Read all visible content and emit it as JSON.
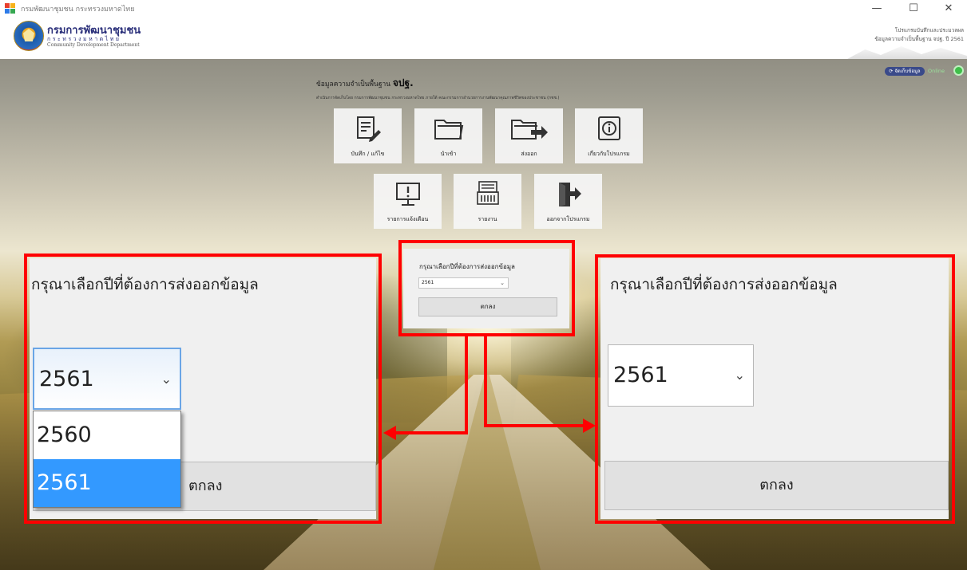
{
  "window": {
    "title": "กรมพัฒนาชุมชน กระทรวงมหาดไทย",
    "minimize_glyph": "—",
    "maximize_glyph": "☐",
    "close_glyph": "✕"
  },
  "header": {
    "org_name_th": "กรมการพัฒนาชุมชน",
    "org_ministry": "กระทรวงมหาดไทย",
    "org_name_en": "Community Development Department",
    "right_line_1": "โปรแกรมบันทึกและประมวลผล",
    "right_line_2": "ข้อมูลความจำเป็นพื้นฐาน จปฐ. ปี 2561"
  },
  "status": {
    "sync_label": "จัดเก็บข้อมูล",
    "online_label": "Online"
  },
  "main": {
    "title_prefix": "ข้อมูลความจำเป็นพื้นฐาน",
    "title_bold": "จปฐ.",
    "description": "ดำเนินการจัดเก็บโดย กรมการพัฒนาชุมชน กระทรวงมหาดไทย ภายใต้ คณะกรรมการอำนวยการงานพัฒนาคุณภาพชีวิตของประชาชน (กชช.)"
  },
  "menu": [
    {
      "label": "บันทึก / แก้ไข",
      "icon": "edit-document-icon"
    },
    {
      "label": "นำเข้า",
      "icon": "folder-icon"
    },
    {
      "label": "ส่งออก",
      "icon": "folder-export-icon"
    },
    {
      "label": "เกี่ยวกับโปรแกรม",
      "icon": "info-icon"
    },
    {
      "label": "รายการแจ้งเตือน",
      "icon": "monitor-alert-icon"
    },
    {
      "label": "รายงาน",
      "icon": "report-icon"
    },
    {
      "label": "ออกจากโปรแกรม",
      "icon": "exit-icon"
    }
  ],
  "export_dialog": {
    "question": "กรุณาเลือกปีที่ต้องการส่งออกข้อมูล",
    "selected_year": "2561",
    "ok_label": "ตกลง"
  },
  "zoom_left": {
    "question": "กรุณาเลือกปีที่ต้องการส่งออกข้อมูล",
    "selected_year": "2561",
    "options": [
      "2560",
      "2561"
    ],
    "highlighted_option": "2561",
    "ok_label": "ตกลง"
  },
  "zoom_right": {
    "question": "กรุณาเลือกปีที่ต้องการส่งออกข้อมูล",
    "selected_year": "2561",
    "ok_label": "ตกลง"
  },
  "colors": {
    "annotation": "#ff0000",
    "dropdown_highlight": "#3399ff",
    "online": "#3fbf4a",
    "brand": "#2a2f7a"
  }
}
